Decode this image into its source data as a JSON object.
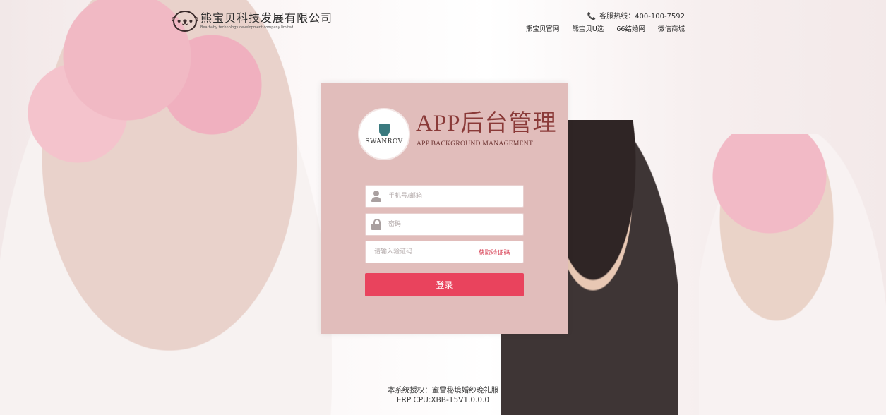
{
  "header": {
    "brand_name": "熊宝贝科技发展有限公司",
    "brand_en": "Bearbaby technology development company limited",
    "hotline": "客服热线：400-100-7592",
    "nav": [
      "熊宝贝官网",
      "熊宝贝U选",
      "66结婚网",
      "微信商城"
    ]
  },
  "panel": {
    "logo_text": "SWANROV",
    "title": "APP后台管理",
    "subtitle": "APP BACKGROUND MANAGEMENT",
    "username_placeholder": "手机号/邮箱",
    "password_placeholder": "密码",
    "captcha_placeholder": "请输入验证码",
    "captcha_link": "获取验证码",
    "login_label": "登录"
  },
  "footer": {
    "line1": "本系统授权：蜜雪秘境婚纱晚礼服",
    "line2": "ERP CPU:XBB-15V1.0.0.0"
  },
  "colors": {
    "panel_bg": "#e1bdbb",
    "button": "#e9435d",
    "title": "#8a3a38"
  }
}
